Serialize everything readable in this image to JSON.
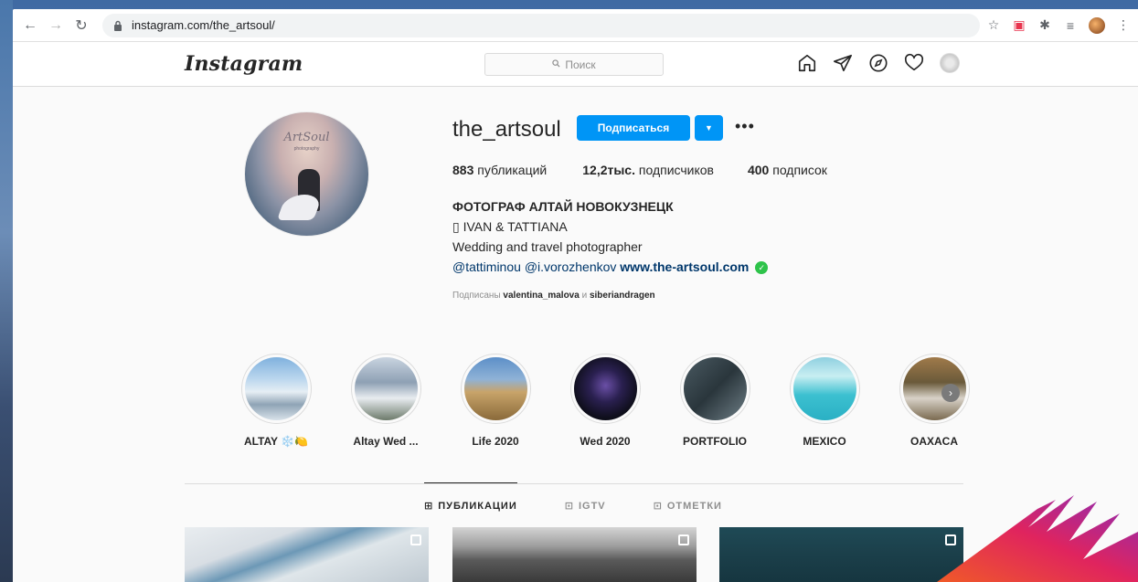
{
  "browser": {
    "url": "instagram.com/the_artsoul/"
  },
  "header": {
    "logo": "Instagram",
    "search_placeholder": "Поиск"
  },
  "profile": {
    "username": "the_artsoul",
    "follow_label": "Подписаться",
    "stats": {
      "posts_value": "883",
      "posts_label": "публикаций",
      "followers_value": "12,2тыс.",
      "followers_label": "подписчиков",
      "following_value": "400",
      "following_label": "подписок"
    },
    "bio": {
      "full_name": "ФОТОГРАФ АЛТАЙ НОВОКУЗНЕЦК",
      "line1": "▯ IVAN & TATTIANA",
      "line2": "Wedding and travel photographer",
      "mention1": "@tattiminou",
      "mention2": "@i.vorozhenkov",
      "website": "www.the-artsoul.com"
    },
    "followed_by": {
      "prefix": "Подписаны",
      "user1": "valentina_malova",
      "conj": "и",
      "user2": "siberiandragen"
    },
    "avatar_brand": "ArtSoul",
    "avatar_sub": "photography"
  },
  "highlights": [
    {
      "label": "ALTAY ❄️🍋"
    },
    {
      "label": "Altay Wed ..."
    },
    {
      "label": "Life 2020"
    },
    {
      "label": "Wed 2020"
    },
    {
      "label": "PORTFOLIO"
    },
    {
      "label": "MEXICO"
    },
    {
      "label": "OAXACA"
    }
  ],
  "tabs": [
    {
      "label": "ПУБЛИКАЦИИ",
      "icon": "grid-icon"
    },
    {
      "label": "IGTV",
      "icon": "igtv-icon"
    },
    {
      "label": "ОТМЕТКИ",
      "icon": "tagged-icon"
    }
  ],
  "colors": {
    "accent": "#0095f6",
    "link": "#00376b",
    "verified": "#2ec34a"
  }
}
